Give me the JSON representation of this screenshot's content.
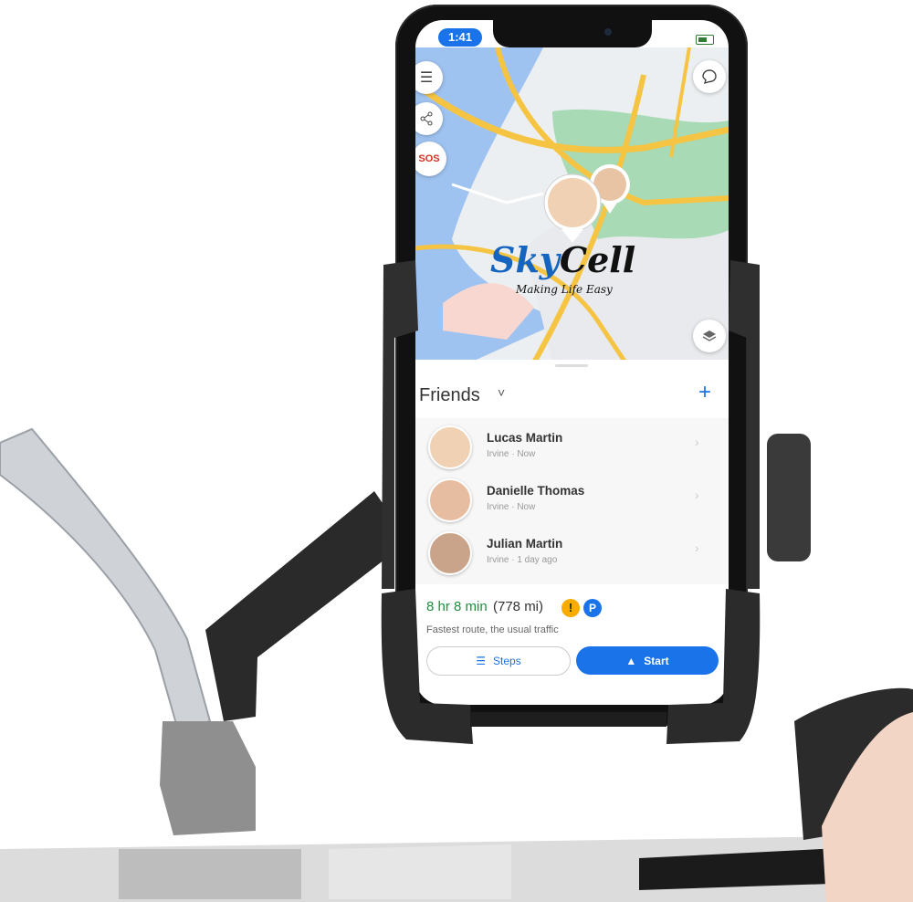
{
  "status_bar": {
    "time": "1:41"
  },
  "map": {
    "sos_label": "SOS",
    "brand_part1": "Sky",
    "brand_part2": "Cell",
    "tagline": "Making Life Easy"
  },
  "friends_panel": {
    "title": "Friends",
    "caret": "˅",
    "add_label": "+",
    "friends": [
      {
        "name": "Lucas Martin",
        "detail": "Irvine · Now"
      },
      {
        "name": "Danielle Thomas",
        "detail": "Irvine · Now"
      },
      {
        "name": "Julian Martin",
        "detail": "Irvine · 1 day ago"
      }
    ]
  },
  "route": {
    "eta": "8 hr 8 min",
    "distance": "(778 mi)",
    "warning_icon": "!",
    "parking_icon": "P",
    "description": "Fastest route, the usual traffic",
    "steps_label": "Steps",
    "start_label": "Start"
  },
  "colors": {
    "accent": "#1a73e8",
    "eta_green": "#1e8e3e",
    "warning": "#f9ab00",
    "brand_blue": "#1565c0"
  },
  "icons": [
    "menu-icon",
    "share-icon",
    "chat-icon",
    "layers-icon",
    "list-icon",
    "navigation-arrow-icon"
  ]
}
